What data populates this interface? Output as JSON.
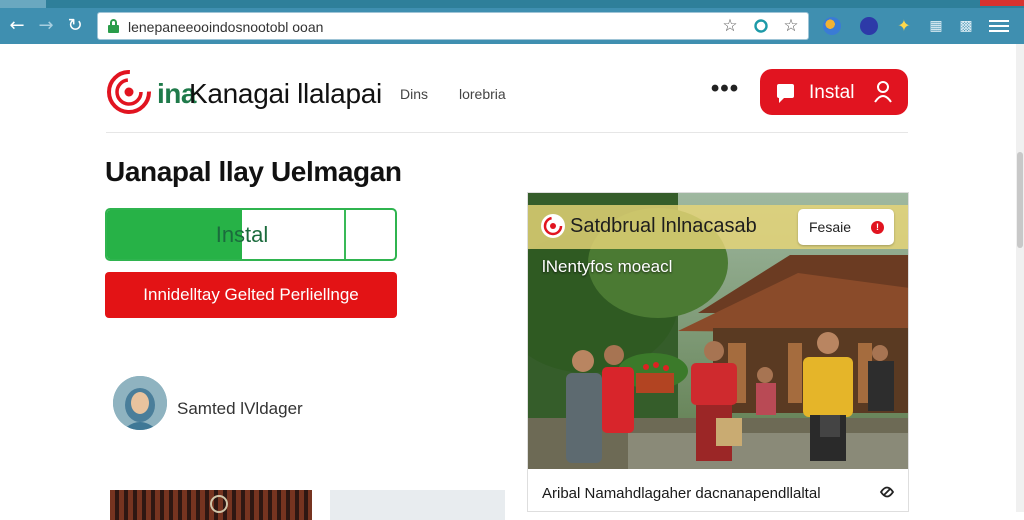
{
  "browser": {
    "url": "lenepaneeooindosnootobl ooan",
    "nav": {
      "back": "←",
      "forward": "→",
      "reload": "↻"
    },
    "toolbar_icons": [
      "star-outline-icon",
      "shield-ring-icon",
      "bookmark-star-icon"
    ],
    "extensions": [
      "colorful-ext-icon",
      "blue-ext-icon",
      "puzzle-ext-icon",
      "grid-ext-icon",
      "qr-ext-icon"
    ],
    "colors": {
      "chrome": "#3f8fb0",
      "lock": "#2a9d4a"
    }
  },
  "header": {
    "brand_word": "ina",
    "title": "Kanagai llalapai",
    "nav_links": [
      "Dins",
      "lorebria"
    ],
    "more": "•••",
    "install_button": "Instal",
    "accent": "#e11420"
  },
  "main": {
    "headline": "Uanapal llay Uelmagan",
    "progress_button": {
      "label": "Instal",
      "progress": 0.47,
      "progress_secondary": 0.83
    },
    "cta_button": "Innidelltay Gelted Perliellnge",
    "author": {
      "name": "Samted lVldager"
    }
  },
  "card": {
    "title": "Satdbrual lnlnacasab",
    "badge": "Fesaie",
    "badge_dot": "!",
    "overlay": "lNentyfos moeacl",
    "caption": "Aribal Namahdlagaher dacnanapendllaltal"
  }
}
